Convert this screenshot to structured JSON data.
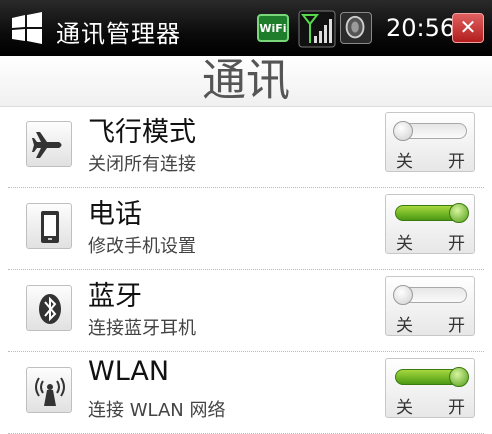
{
  "status_bar": {
    "app_title": "通讯管理器",
    "wifi_badge": "WiFi",
    "time": "20:56",
    "close_glyph": "✕",
    "icons": [
      "windows-logo-icon",
      "wifi-icon",
      "signal-icon",
      "speaker-icon",
      "close-icon"
    ]
  },
  "page": {
    "title": "通讯"
  },
  "settings": [
    {
      "title": "飞行模式",
      "subtitle": "关闭所有连接",
      "icon": "airplane-icon",
      "state": "off",
      "off_label": "关",
      "on_label": "开"
    },
    {
      "title": "电话",
      "subtitle": "修改手机设置",
      "icon": "phone-icon",
      "state": "on",
      "off_label": "关",
      "on_label": "开"
    },
    {
      "title": "蓝牙",
      "subtitle": "连接蓝牙耳机",
      "icon": "bluetooth-icon",
      "state": "off",
      "off_label": "关",
      "on_label": "开"
    },
    {
      "title": "WLAN",
      "subtitle": "连接 WLAN 网络",
      "icon": "wlan-antenna-icon",
      "state": "on",
      "off_label": "关",
      "on_label": "开"
    }
  ],
  "colors": {
    "toggle_on": "#5aa81c",
    "titlebar": "#0b0b0b",
    "close": "#c42b2b"
  }
}
